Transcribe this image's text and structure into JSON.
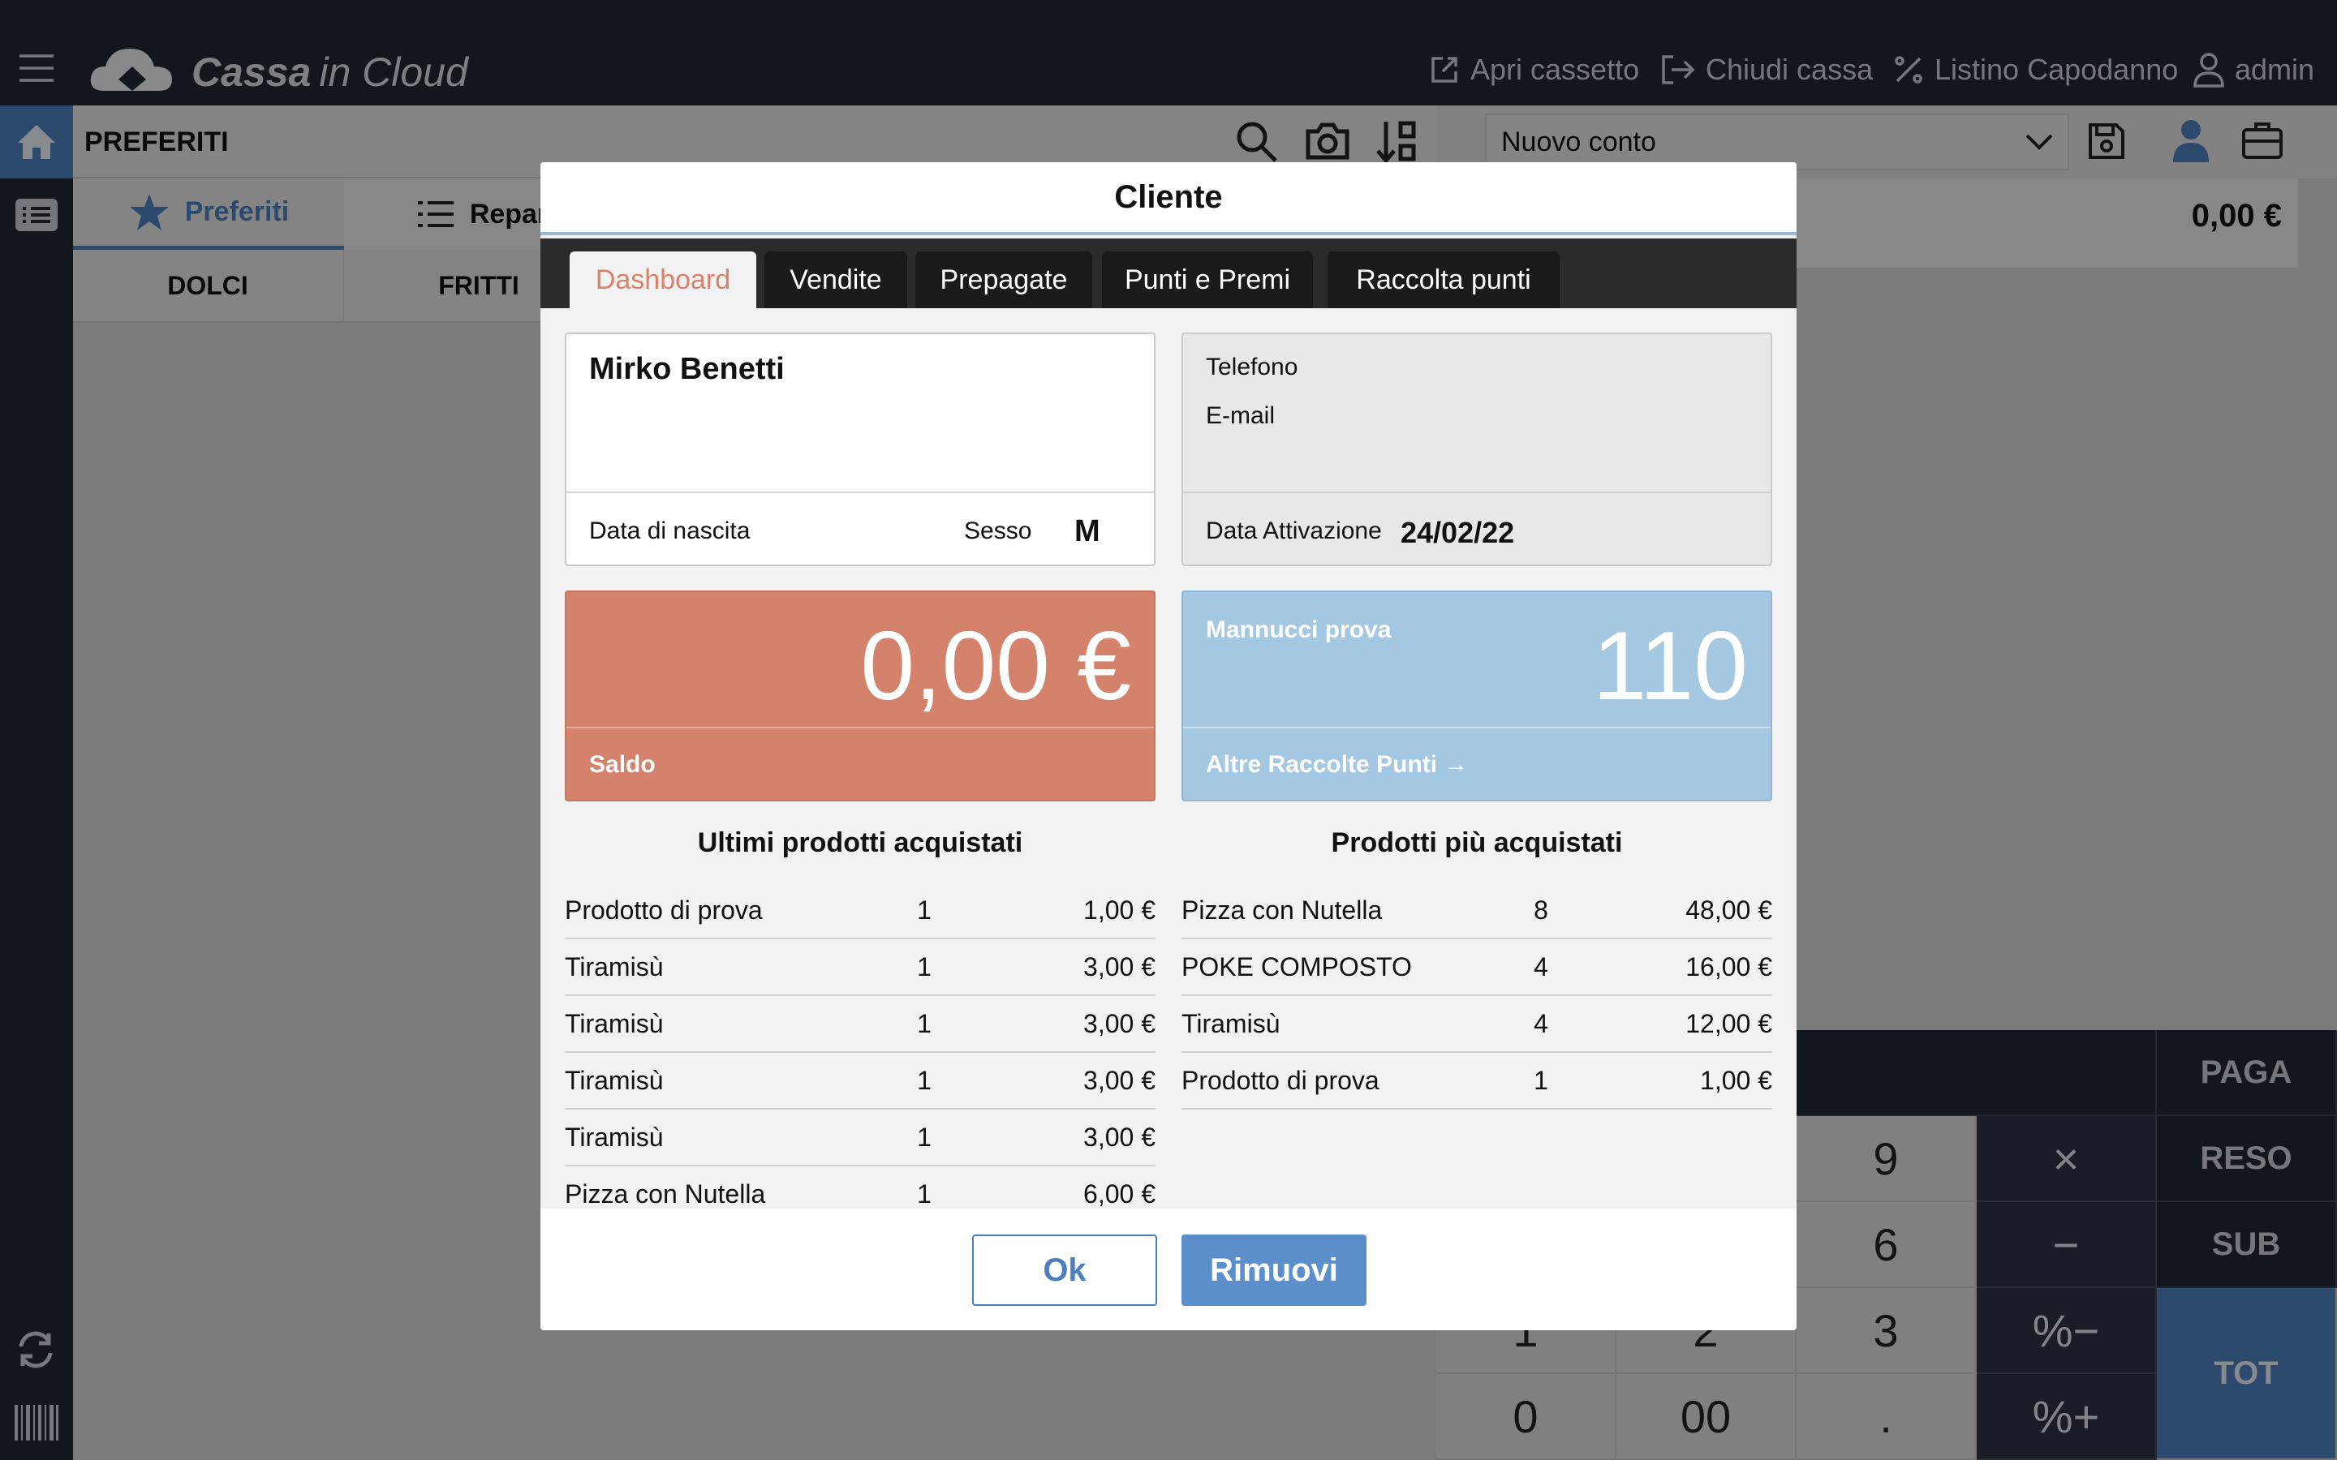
{
  "app": {
    "logo_main": "Cassa",
    "logo_sub": "in Cloud"
  },
  "header": {
    "open_drawer": "Apri cassetto",
    "close_register": "Chiudi cassa",
    "price_list": "Listino Capodanno",
    "user": "admin"
  },
  "left": {
    "section_title": "PREFERITI",
    "tabs": [
      "Preferiti",
      "Repar"
    ],
    "categories": [
      "DOLCI",
      "FRITTI"
    ]
  },
  "right": {
    "account_select": "Nuovo conto",
    "total": "0,00 €"
  },
  "keypad": {
    "digits": [
      "1",
      "2",
      "3",
      "0",
      "00",
      ".",
      "9",
      "6"
    ],
    "ops": [
      "×",
      "−",
      "%−",
      "%+"
    ],
    "fn": [
      "PAGA",
      "RESO",
      "SUB",
      "TOT"
    ]
  },
  "modal": {
    "title": "Cliente",
    "tabs": [
      "Dashboard",
      "Vendite",
      "Prepagate",
      "Punti e Premi",
      "Raccolta punti"
    ],
    "customer": {
      "name": "Mirko Benetti",
      "birth_label": "Data di nascita",
      "sex_label": "Sesso",
      "sex_value": "M"
    },
    "contact": {
      "phone_label": "Telefono",
      "email_label": "E-mail",
      "activation_label": "Data Attivazione",
      "activation_value": "24/02/22"
    },
    "balance": {
      "amount": "0,00 €",
      "label": "Saldo"
    },
    "points": {
      "name": "Mannucci prova",
      "value": "110",
      "more": "Altre Raccolte Punti →"
    },
    "last_title": "Ultimi prodotti acquistati",
    "last_products": [
      {
        "name": "Prodotto di prova",
        "qty": "1",
        "price": "1,00 €"
      },
      {
        "name": "Tiramisù",
        "qty": "1",
        "price": "3,00 €"
      },
      {
        "name": "Tiramisù",
        "qty": "1",
        "price": "3,00 €"
      },
      {
        "name": "Tiramisù",
        "qty": "1",
        "price": "3,00 €"
      },
      {
        "name": "Tiramisù",
        "qty": "1",
        "price": "3,00 €"
      },
      {
        "name": "Pizza con Nutella",
        "qty": "1",
        "price": "6,00 €"
      }
    ],
    "top_title": "Prodotti più acquistati",
    "top_products": [
      {
        "name": "Pizza con Nutella",
        "qty": "8",
        "price": "48,00 €"
      },
      {
        "name": "POKE COMPOSTO",
        "qty": "4",
        "price": "16,00 €"
      },
      {
        "name": "Tiramisù",
        "qty": "4",
        "price": "12,00 €"
      },
      {
        "name": "Prodotto di prova",
        "qty": "1",
        "price": "1,00 €"
      }
    ],
    "ok": "Ok",
    "remove": "Rimuovi"
  }
}
